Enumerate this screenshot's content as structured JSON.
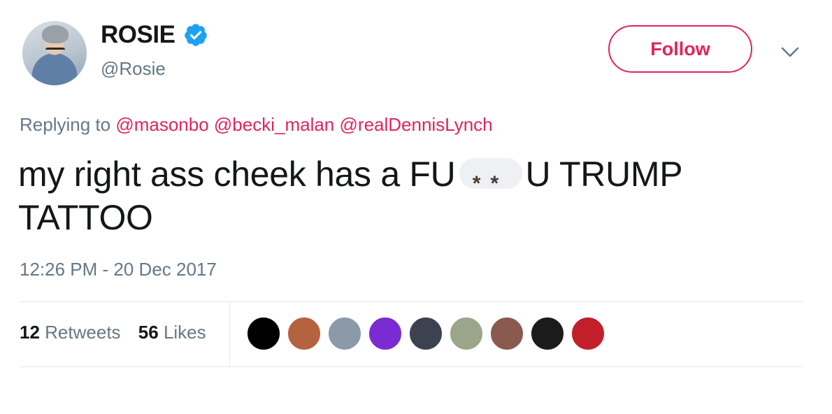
{
  "user": {
    "display_name": "ROSIE",
    "handle": "@Rosie",
    "verified": true
  },
  "follow_button": {
    "label": "Follow"
  },
  "reply": {
    "prefix": "Replying to",
    "mentions": [
      "@masonbo",
      "@becki_malan",
      "@realDennisLynch"
    ]
  },
  "tweet": {
    "text_before": "my right ass cheek has a FU",
    "censor_glyph": "**",
    "text_after": "U TRUMP TATTOO"
  },
  "timestamp": "12:26 PM - 20 Dec 2017",
  "stats": {
    "retweets_count": "12",
    "retweets_label": "Retweets",
    "likes_count": "56",
    "likes_label": "Likes"
  },
  "likers": [
    {
      "name": "liker-avatar-1",
      "color": "#000000"
    },
    {
      "name": "liker-avatar-2",
      "color": "#b5633f"
    },
    {
      "name": "liker-avatar-3",
      "color": "#8a9aa8"
    },
    {
      "name": "liker-avatar-4",
      "color": "#7a2bd1"
    },
    {
      "name": "liker-avatar-5",
      "color": "#3c4250"
    },
    {
      "name": "liker-avatar-6",
      "color": "#9aa58a"
    },
    {
      "name": "liker-avatar-7",
      "color": "#8b5a4e"
    },
    {
      "name": "liker-avatar-8",
      "color": "#1b1b1b"
    },
    {
      "name": "liker-avatar-9",
      "color": "#c21f2b"
    }
  ],
  "colors": {
    "accent": "#e0245e",
    "verified": "#1da1f2",
    "muted": "#657786",
    "text": "#14171a"
  }
}
